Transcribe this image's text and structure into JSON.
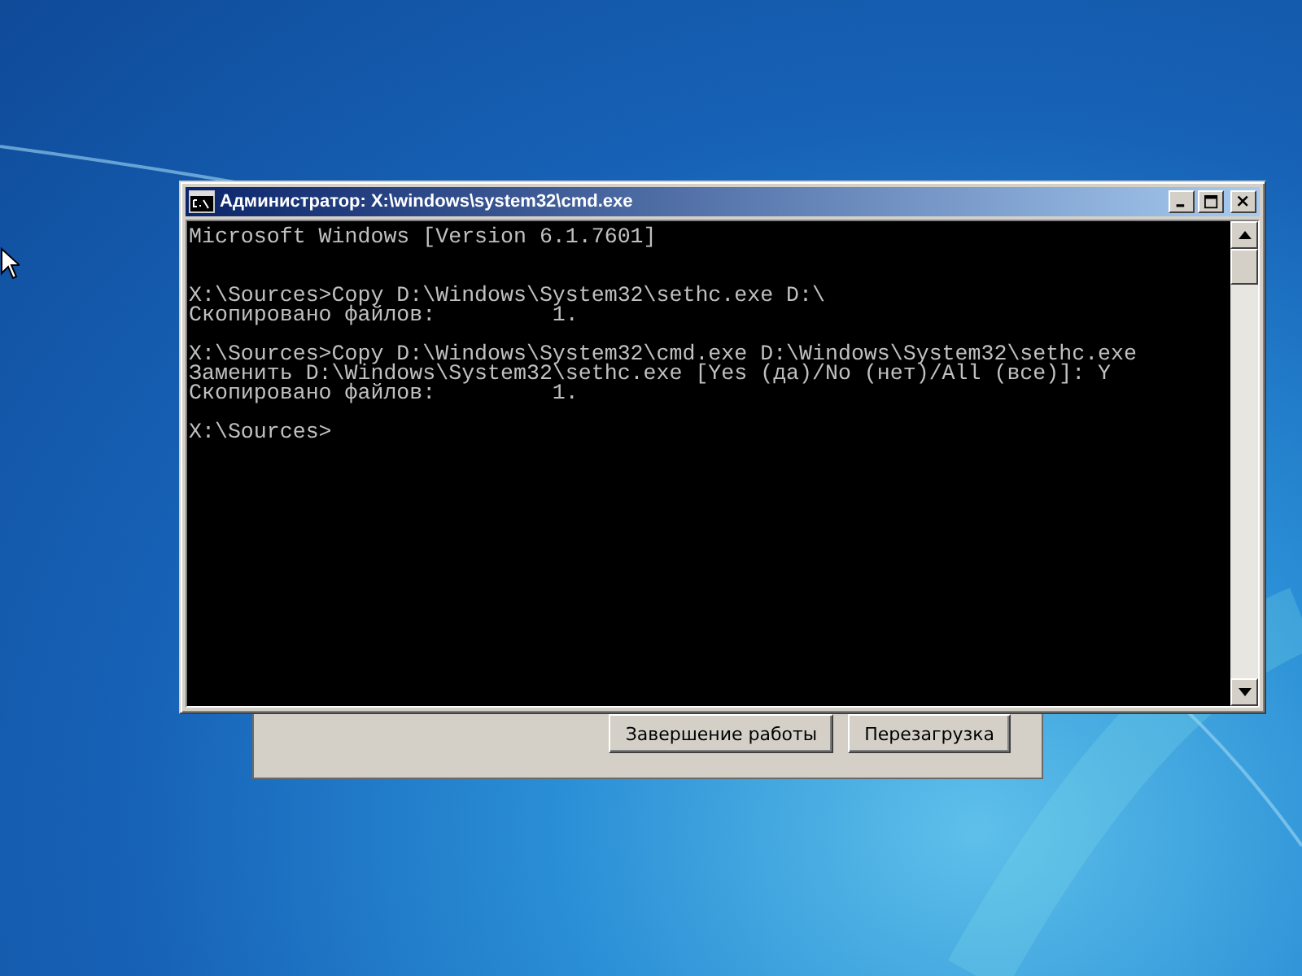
{
  "console_window": {
    "title": "Администратор: X:\\windows\\system32\\cmd.exe",
    "paragraphs": [
      [
        "Microsoft Windows [Version 6.1.7601]"
      ],
      [
        "X:\\Sources>Copy D:\\Windows\\System32\\sethc.exe D:\\",
        "Скопировано файлов:         1."
      ],
      [
        "X:\\Sources>Copy D:\\Windows\\System32\\cmd.exe D:\\Windows\\System32\\sethc.exe",
        "Заменить D:\\Windows\\System32\\sethc.exe [Yes (да)/No (нет)/All (все)]: Y",
        "Скопировано файлов:         1."
      ],
      [
        "X:\\Sources>"
      ]
    ]
  },
  "background_dialog": {
    "buttons": [
      "Завершение работы",
      "Перезагрузка"
    ]
  }
}
